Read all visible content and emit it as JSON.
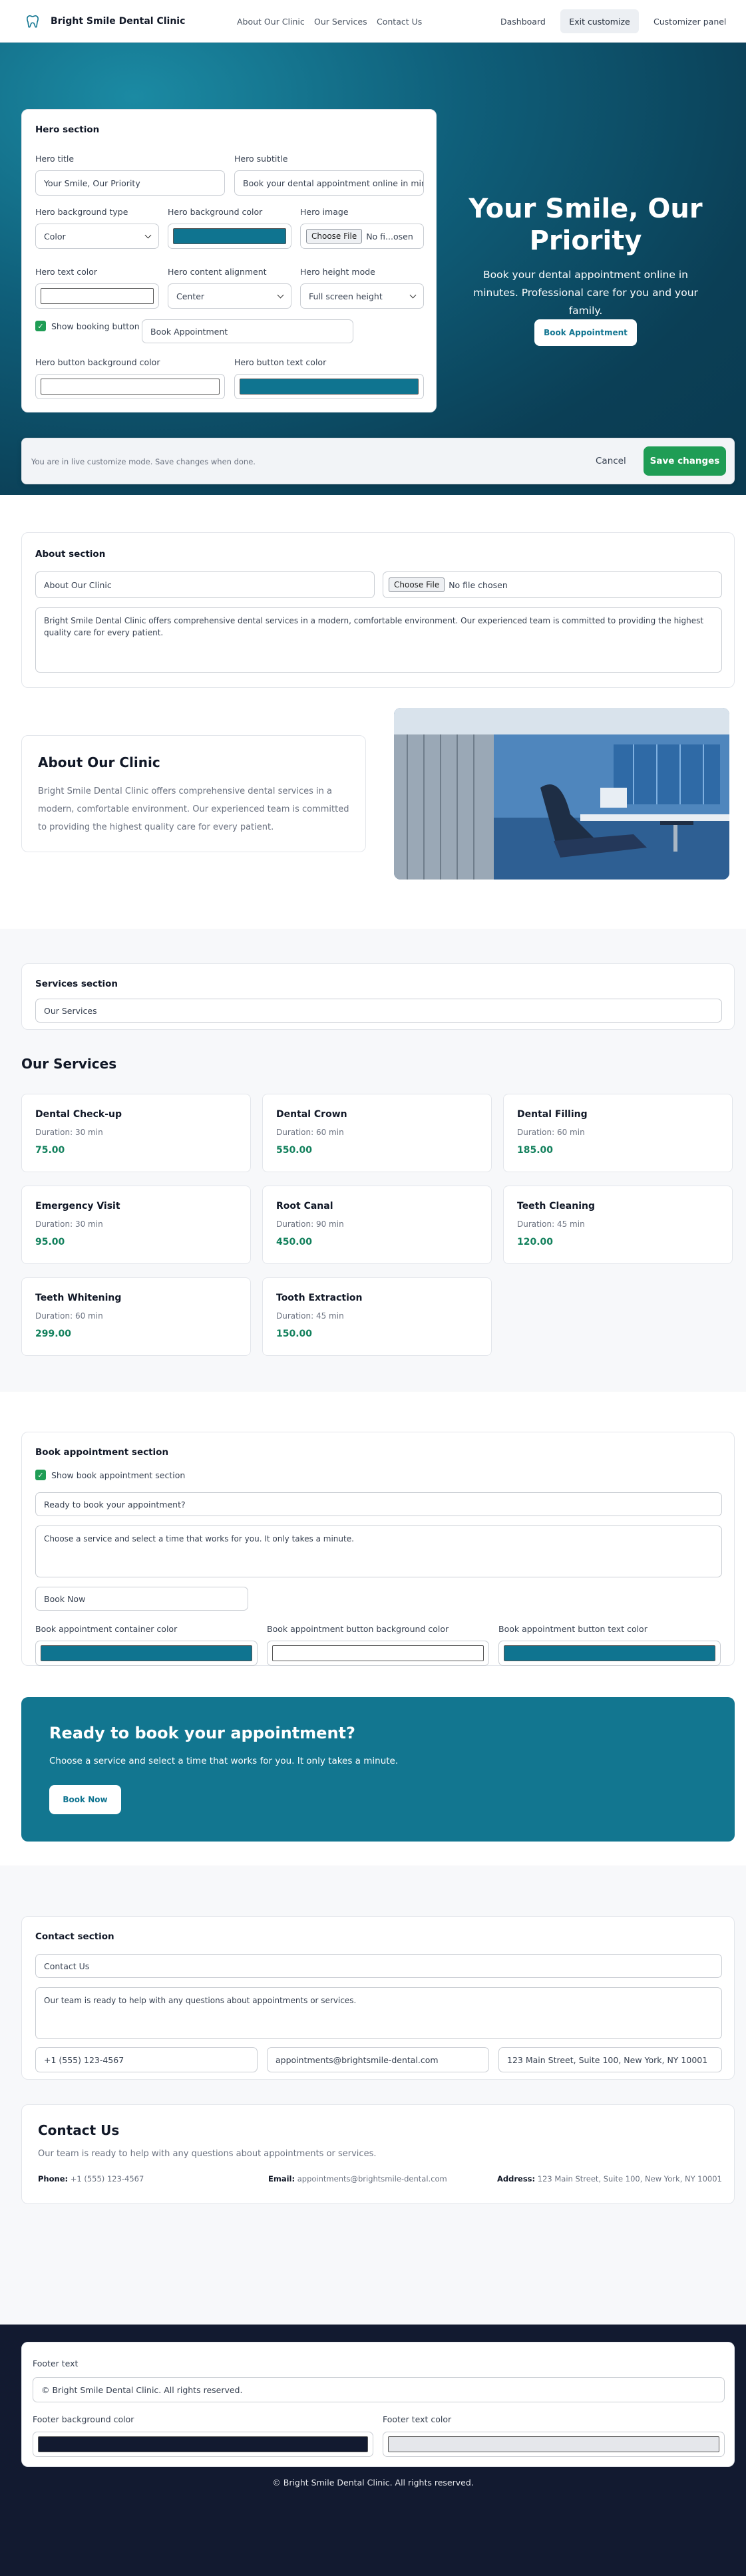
{
  "header": {
    "brand": "Bright Smile Dental Clinic",
    "nav": [
      "About Our Clinic",
      "Our Services",
      "Contact Us"
    ],
    "dashboard": "Dashboard",
    "exit_customize": "Exit customize",
    "customizer_panel": "Customizer panel"
  },
  "hero_panel": {
    "section_title": "Hero section",
    "title_label": "Hero title",
    "title_value": "Your Smile, Our Priority",
    "subtitle_label": "Hero subtitle",
    "subtitle_value": "Book your dental appointment online in minu",
    "bg_type_label": "Hero background type",
    "bg_type_value": "Color",
    "bg_color_label": "Hero background color",
    "image_label": "Hero image",
    "choose_file": "Choose File",
    "no_file_short": "No fi...osen",
    "text_color_label": "Hero text color",
    "alignment_label": "Hero content alignment",
    "alignment_value": "Center",
    "height_label": "Hero height mode",
    "height_value": "Full screen height",
    "show_booking_label": "Show booking button",
    "booking_text_value": "Book Appointment",
    "btn_bg_label": "Hero button background color",
    "btn_text_label": "Hero button text color"
  },
  "hero": {
    "title": "Your Smile, Our Priority",
    "subtitle": "Book your dental appointment online in minutes. Professional care for you and your family.",
    "button": "Book Appointment"
  },
  "live_bar": {
    "message": "You are in live customize mode. Save changes when done.",
    "cancel": "Cancel",
    "save": "Save changes"
  },
  "about_panel": {
    "section_title": "About section",
    "title_value": "About Our Clinic",
    "choose_file": "Choose File",
    "no_file": "No file chosen",
    "body_value": "Bright Smile Dental Clinic offers comprehensive dental services in a modern, comfortable environment. Our experienced team is committed to providing the highest quality care for every patient."
  },
  "about": {
    "title": "About Our Clinic",
    "body": "Bright Smile Dental Clinic offers comprehensive dental services in a modern, comfortable environment. Our experienced team is committed to providing the highest quality care for every patient."
  },
  "services_panel": {
    "section_title": "Services section",
    "title_value": "Our Services"
  },
  "services": {
    "title": "Our Services",
    "items": [
      {
        "name": "Dental Check-up",
        "duration": "Duration: 30 min",
        "price": "75.00"
      },
      {
        "name": "Dental Crown",
        "duration": "Duration: 60 min",
        "price": "550.00"
      },
      {
        "name": "Dental Filling",
        "duration": "Duration: 60 min",
        "price": "185.00"
      },
      {
        "name": "Emergency Visit",
        "duration": "Duration: 30 min",
        "price": "95.00"
      },
      {
        "name": "Root Canal",
        "duration": "Duration: 90 min",
        "price": "450.00"
      },
      {
        "name": "Teeth Cleaning",
        "duration": "Duration: 45 min",
        "price": "120.00"
      },
      {
        "name": "Teeth Whitening",
        "duration": "Duration: 60 min",
        "price": "299.00"
      },
      {
        "name": "Tooth Extraction",
        "duration": "Duration: 45 min",
        "price": "150.00"
      }
    ]
  },
  "book_panel": {
    "section_title": "Book appointment section",
    "show_label": "Show book appointment section",
    "title_value": "Ready to book your appointment?",
    "body_value": "Choose a service and select a time that works for you. It only takes a minute.",
    "button_value": "Book Now",
    "container_color_label": "Book appointment container color",
    "btn_bg_label": "Book appointment button background color",
    "btn_text_label": "Book appointment button text color"
  },
  "book": {
    "title": "Ready to book your appointment?",
    "body": "Choose a service and select a time that works for you. It only takes a minute.",
    "button": "Book Now"
  },
  "contact_panel": {
    "section_title": "Contact section",
    "title_value": "Contact Us",
    "body_value": "Our team is ready to help with any questions about appointments or services.",
    "phone_value": "+1 (555) 123-4567",
    "email_value": "appointments@brightsmile-dental.com",
    "address_value": "123 Main Street, Suite 100, New York, NY 10001"
  },
  "contact": {
    "title": "Contact Us",
    "body": "Our team is ready to help with any questions about appointments or services.",
    "phone_label": "Phone:",
    "phone": "+1 (555) 123-4567",
    "email_label": "Email:",
    "email": "appointments@brightsmile-dental.com",
    "address_label": "Address:",
    "address": "123 Main Street, Suite 100, New York, NY 10001"
  },
  "footer_panel": {
    "text_label": "Footer text",
    "text_value": "© Bright Smile Dental Clinic. All rights reserved.",
    "bg_label": "Footer background color",
    "text_color_label": "Footer text color"
  },
  "footer": {
    "text": "© Bright Smile Dental Clinic. All rights reserved."
  },
  "colors": {
    "primary": "#0f7490",
    "hero_bg": "#0d4a63",
    "footer_bg": "#121a30",
    "success": "#1f9d55",
    "footer_text_color": "#e5e7eb"
  }
}
